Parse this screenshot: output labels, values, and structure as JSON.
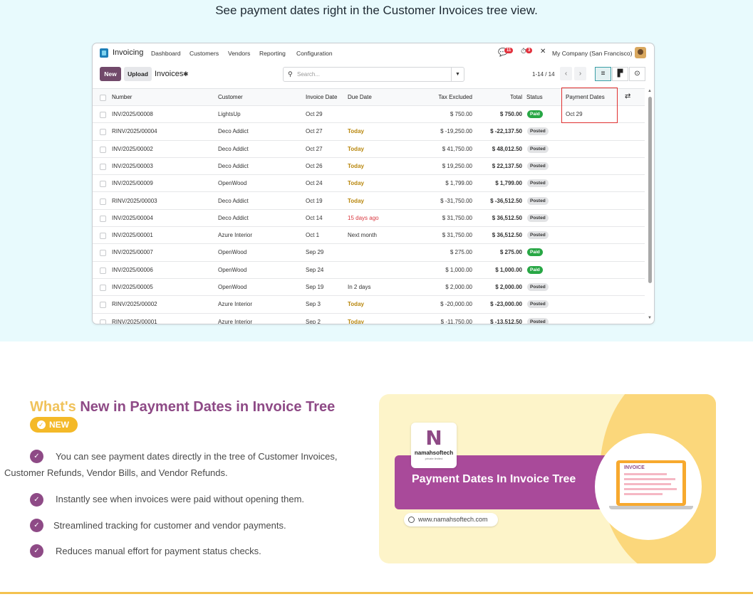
{
  "caption": "See payment dates right in the Customer Invoices tree view.",
  "navbar": {
    "app": "Invoicing",
    "menu": [
      "Dashboard",
      "Customers",
      "Vendors",
      "Reporting",
      "Configuration"
    ],
    "chat_count": "11",
    "activity_count": "3",
    "company": "My Company (San Francisco)"
  },
  "controls": {
    "new_label": "New",
    "upload_label": "Upload",
    "breadcrumb": "Invoices",
    "search_placeholder": "Search...",
    "pager": "1-14 / 14"
  },
  "table": {
    "headers": {
      "number": "Number",
      "customer": "Customer",
      "invoice_date": "Invoice Date",
      "due_date": "Due Date",
      "tax_excluded": "Tax Excluded",
      "total": "Total",
      "status": "Status",
      "payment_dates": "Payment Dates"
    },
    "rows": [
      {
        "number": "INV/2025/00008",
        "customer": "LightsUp",
        "invoice_date": "Oct 29",
        "due_date": "",
        "due_kind": "none",
        "tax_excluded": "$ 750.00",
        "total": "$ 750.00",
        "status": "Paid",
        "payment_dates": "Oct 29"
      },
      {
        "number": "RINV/2025/00004",
        "customer": "Deco Addict",
        "invoice_date": "Oct 27",
        "due_date": "Today",
        "due_kind": "today",
        "tax_excluded": "$ -19,250.00",
        "total": "$ -22,137.50",
        "status": "Posted",
        "payment_dates": ""
      },
      {
        "number": "INV/2025/00002",
        "customer": "Deco Addict",
        "invoice_date": "Oct 27",
        "due_date": "Today",
        "due_kind": "today",
        "tax_excluded": "$ 41,750.00",
        "total": "$ 48,012.50",
        "status": "Posted",
        "payment_dates": ""
      },
      {
        "number": "INV/2025/00003",
        "customer": "Deco Addict",
        "invoice_date": "Oct 26",
        "due_date": "Today",
        "due_kind": "today",
        "tax_excluded": "$ 19,250.00",
        "total": "$ 22,137.50",
        "status": "Posted",
        "payment_dates": ""
      },
      {
        "number": "INV/2025/00009",
        "customer": "OpenWood",
        "invoice_date": "Oct 24",
        "due_date": "Today",
        "due_kind": "today",
        "tax_excluded": "$ 1,799.00",
        "total": "$ 1,799.00",
        "status": "Posted",
        "payment_dates": ""
      },
      {
        "number": "RINV/2025/00003",
        "customer": "Deco Addict",
        "invoice_date": "Oct 19",
        "due_date": "Today",
        "due_kind": "today",
        "tax_excluded": "$ -31,750.00",
        "total": "$ -36,512.50",
        "status": "Posted",
        "payment_dates": ""
      },
      {
        "number": "INV/2025/00004",
        "customer": "Deco Addict",
        "invoice_date": "Oct 14",
        "due_date": "15 days ago",
        "due_kind": "late",
        "tax_excluded": "$ 31,750.00",
        "total": "$ 36,512.50",
        "status": "Posted",
        "payment_dates": ""
      },
      {
        "number": "INV/2025/00001",
        "customer": "Azure Interior",
        "invoice_date": "Oct 1",
        "due_date": "Next month",
        "due_kind": "normal",
        "tax_excluded": "$ 31,750.00",
        "total": "$ 36,512.50",
        "status": "Posted",
        "payment_dates": ""
      },
      {
        "number": "INV/2025/00007",
        "customer": "OpenWood",
        "invoice_date": "Sep 29",
        "due_date": "",
        "due_kind": "none",
        "tax_excluded": "$ 275.00",
        "total": "$ 275.00",
        "status": "Paid",
        "payment_dates": ""
      },
      {
        "number": "INV/2025/00006",
        "customer": "OpenWood",
        "invoice_date": "Sep 24",
        "due_date": "",
        "due_kind": "none",
        "tax_excluded": "$ 1,000.00",
        "total": "$ 1,000.00",
        "status": "Paid",
        "payment_dates": ""
      },
      {
        "number": "INV/2025/00005",
        "customer": "OpenWood",
        "invoice_date": "Sep 19",
        "due_date": "In 2 days",
        "due_kind": "normal",
        "tax_excluded": "$ 2,000.00",
        "total": "$ 2,000.00",
        "status": "Posted",
        "payment_dates": ""
      },
      {
        "number": "RINV/2025/00002",
        "customer": "Azure Interior",
        "invoice_date": "Sep 3",
        "due_date": "Today",
        "due_kind": "today",
        "tax_excluded": "$ -20,000.00",
        "total": "$ -23,000.00",
        "status": "Posted",
        "payment_dates": ""
      },
      {
        "number": "RINV/2025/00001",
        "customer": "Azure Interior",
        "invoice_date": "Sep 2",
        "due_date": "Today",
        "due_kind": "today",
        "tax_excluded": "$ -11,750.00",
        "total": "$ -13,512.50",
        "status": "Posted",
        "payment_dates": ""
      }
    ]
  },
  "section": {
    "heading_word1": "What's",
    "heading_rest": "New in Payment Dates in Invoice Tree",
    "badge": "NEW",
    "features": [
      "You can see payment dates directly in the tree of Customer Invoices,",
      "Customer Refunds, Vendor Bills, and Vendor Refunds.",
      "Instantly see when invoices were paid without opening them.",
      "Streamlined tracking for customer and vendor payments.",
      "Reduces manual effort for payment status checks."
    ]
  },
  "banner": {
    "brand": "namahsoftech",
    "brand_sub": "private limited",
    "title": "Payment Dates In Invoice Tree",
    "url": "www.namahsoftech.com",
    "invoice_label": "INVOICE"
  },
  "colors": {
    "accent_purple": "#8e4a86",
    "accent_yellow": "#f4b928",
    "paid_green": "#28a745",
    "highlight_red": "#e03030"
  }
}
